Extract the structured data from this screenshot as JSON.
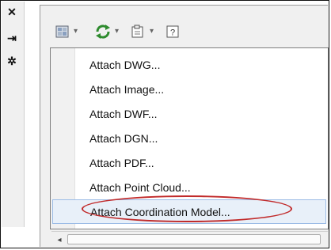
{
  "side": {
    "close_glyph": "✕",
    "pin_glyph": "⇥",
    "settings_glyph": "✲"
  },
  "toolbar": {
    "attach_icon": "attach-xref-icon",
    "refresh_icon": "refresh-icon",
    "change_path_icon": "change-path-icon",
    "help_icon": "help-icon",
    "dropdown_glyph": "▾",
    "help_glyph": "?"
  },
  "menu": {
    "items": [
      {
        "label": "Attach DWG..."
      },
      {
        "label": "Attach Image..."
      },
      {
        "label": "Attach DWF..."
      },
      {
        "label": "Attach DGN..."
      },
      {
        "label": "Attach PDF..."
      },
      {
        "label": "Attach Point Cloud..."
      },
      {
        "label": "Attach Coordination Model..."
      }
    ],
    "selected_index": 6
  },
  "scrollbar": {
    "left_arrow_glyph": "◂"
  },
  "colors": {
    "highlight_circle": "#c12a2a",
    "refresh_green": "#2e8b2e",
    "selected_bg": "#e8f0f9"
  }
}
